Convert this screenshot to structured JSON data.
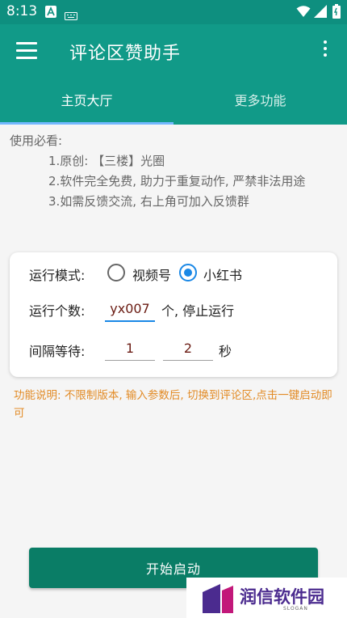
{
  "status_bar": {
    "time": "8:13",
    "icons": [
      "notification-a-icon",
      "keyboard-icon",
      "wifi-icon",
      "signal-icon",
      "battery-icon"
    ]
  },
  "app_bar": {
    "title": "评论区赞助手",
    "color": "#119a88"
  },
  "tabs": [
    {
      "label": "主页大厅",
      "selected": true
    },
    {
      "label": "更多功能",
      "selected": false
    }
  ],
  "instructions": {
    "heading": "使用必看:",
    "line1": "1.原创: 【三楼】光圈",
    "line2": "2.软件完全免费, 助力于重复动作, 严禁非法用途",
    "line3": "3.如需反馈交流, 右上角可加入反馈群"
  },
  "settings": {
    "mode_label": "运行模式:",
    "mode_options": [
      {
        "label": "视频号",
        "checked": false
      },
      {
        "label": "小红书",
        "checked": true
      }
    ],
    "count_label": "运行个数:",
    "count_value": "yx007",
    "count_suffix": "个, 停止运行",
    "interval_label": "间隔等待:",
    "interval_min": "1",
    "interval_max": "2",
    "interval_unit": "秒"
  },
  "function_note": "功能说明: 不限制版本, 输入参数后, 切换到评论区,点击一键启动即可",
  "start_button": "开始启动",
  "watermark": {
    "brand": "润信软件园",
    "slogan": "SLOGAN"
  },
  "colors": {
    "accent": "#119a88",
    "radio_checked": "#1a88e6",
    "note": "#e28b26",
    "button": "#0a7d66"
  }
}
